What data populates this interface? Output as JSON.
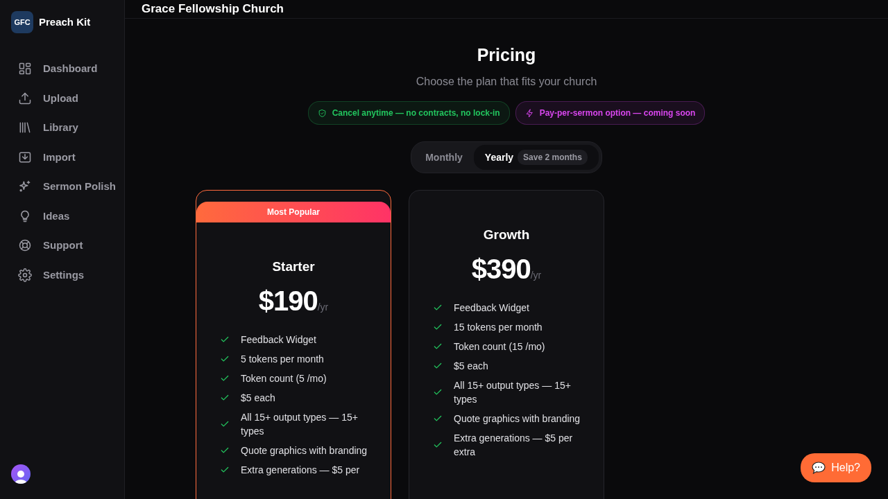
{
  "app": {
    "logo_initials": "GFC",
    "name": "Preach Kit"
  },
  "sidebar": {
    "items": [
      {
        "label": "Dashboard"
      },
      {
        "label": "Upload"
      },
      {
        "label": "Library"
      },
      {
        "label": "Import"
      },
      {
        "label": "Sermon Polish"
      },
      {
        "label": "Ideas"
      },
      {
        "label": "Support"
      },
      {
        "label": "Settings"
      }
    ]
  },
  "header": {
    "title": "Grace Fellowship Church"
  },
  "pricing": {
    "title": "Pricing",
    "subtitle": "Choose the plan that fits your church",
    "notes": [
      {
        "text": "Cancel anytime — no contracts, no lock-in",
        "color": "#22c55e"
      },
      {
        "text": "Pay-per-sermon option — coming soon",
        "color": "#d946ef"
      }
    ],
    "billing_toggle": [
      {
        "label": "Monthly",
        "selected": false
      },
      {
        "label": "Yearly",
        "selected": true,
        "tag": "Save 2 months"
      }
    ],
    "plans": [
      {
        "name": "Starter",
        "badge": "Most Popular",
        "featured": true,
        "price": "$190",
        "period": "/yr",
        "features": [
          "Feedback Widget",
          "5 tokens per month",
          "Token count (5 /mo)",
          "$5 each",
          "All 15+ output types — 15+ types",
          "Quote graphics with branding",
          "Extra generations — $5 per"
        ]
      },
      {
        "name": "Growth",
        "featured": false,
        "price": "$390",
        "period": "/yr",
        "features": [
          "Feedback Widget",
          "15 tokens per month",
          "Token count (15 /mo)",
          "$5 each",
          "All 15+ output types — 15+ types",
          "Quote graphics with branding",
          "Extra generations — $5 per extra"
        ]
      }
    ]
  },
  "help_button": {
    "label": "Help?"
  }
}
